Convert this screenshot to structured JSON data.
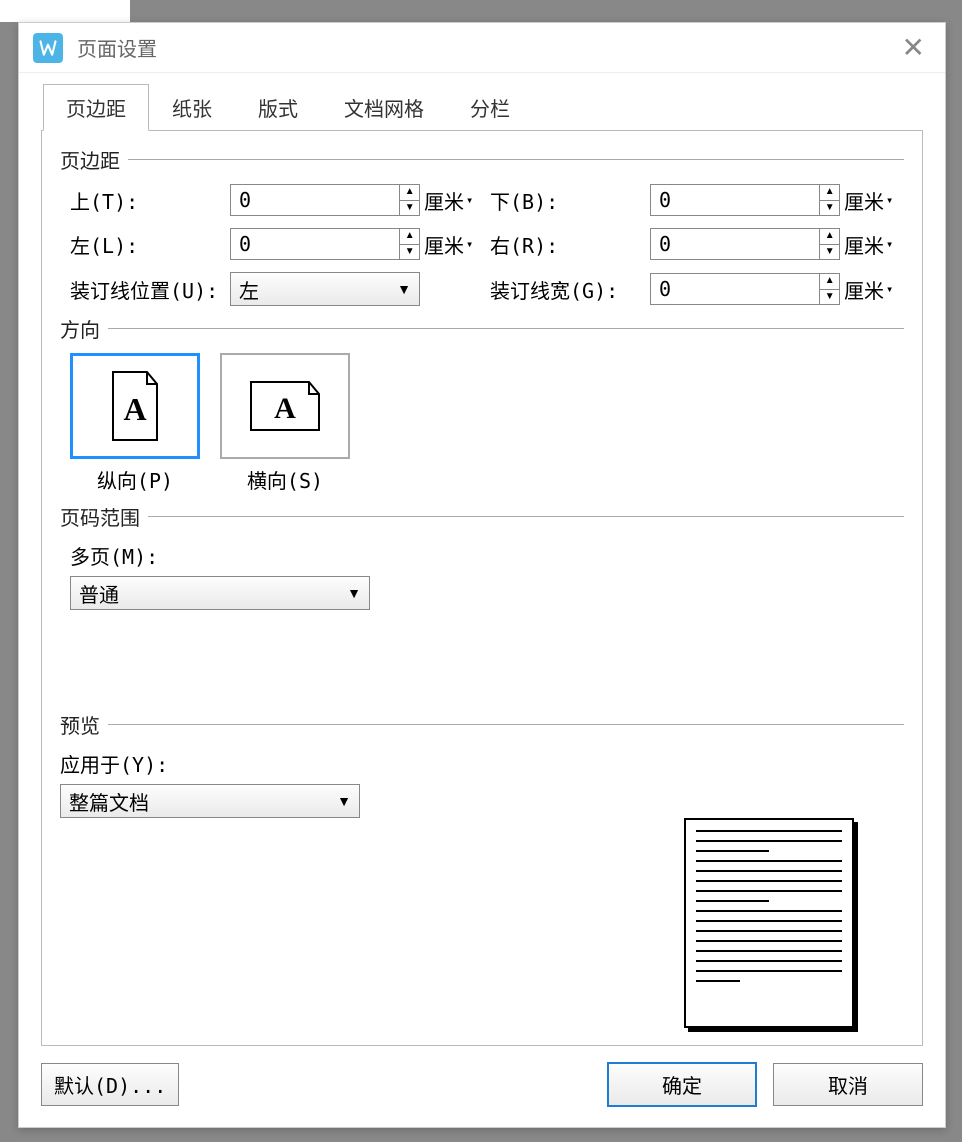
{
  "window": {
    "title": "页面设置"
  },
  "tabs": {
    "margins": "页边距",
    "paper": "纸张",
    "layout": "版式",
    "grid": "文档网格",
    "columns": "分栏"
  },
  "groups": {
    "margins": "页边距",
    "orientation": "方向",
    "page_range": "页码范围",
    "preview": "预览"
  },
  "margins": {
    "top_label": "上(T):",
    "top_value": "0",
    "top_unit": "厘米",
    "bottom_label": "下(B):",
    "bottom_value": "0",
    "bottom_unit": "厘米",
    "left_label": "左(L):",
    "left_value": "0",
    "left_unit": "厘米",
    "right_label": "右(R):",
    "right_value": "0",
    "right_unit": "厘米",
    "gutter_pos_label": "装订线位置(U):",
    "gutter_pos_value": "左",
    "gutter_width_label": "装订线宽(G):",
    "gutter_width_value": "0",
    "gutter_width_unit": "厘米"
  },
  "orientation": {
    "portrait": "纵向(P)",
    "landscape": "横向(S)"
  },
  "page_range": {
    "multi_label": "多页(M):",
    "multi_value": "普通"
  },
  "preview": {
    "apply_to_label": "应用于(Y):",
    "apply_to_value": "整篇文档"
  },
  "buttons": {
    "default": "默认(D)...",
    "ok": "确定",
    "cancel": "取消"
  }
}
